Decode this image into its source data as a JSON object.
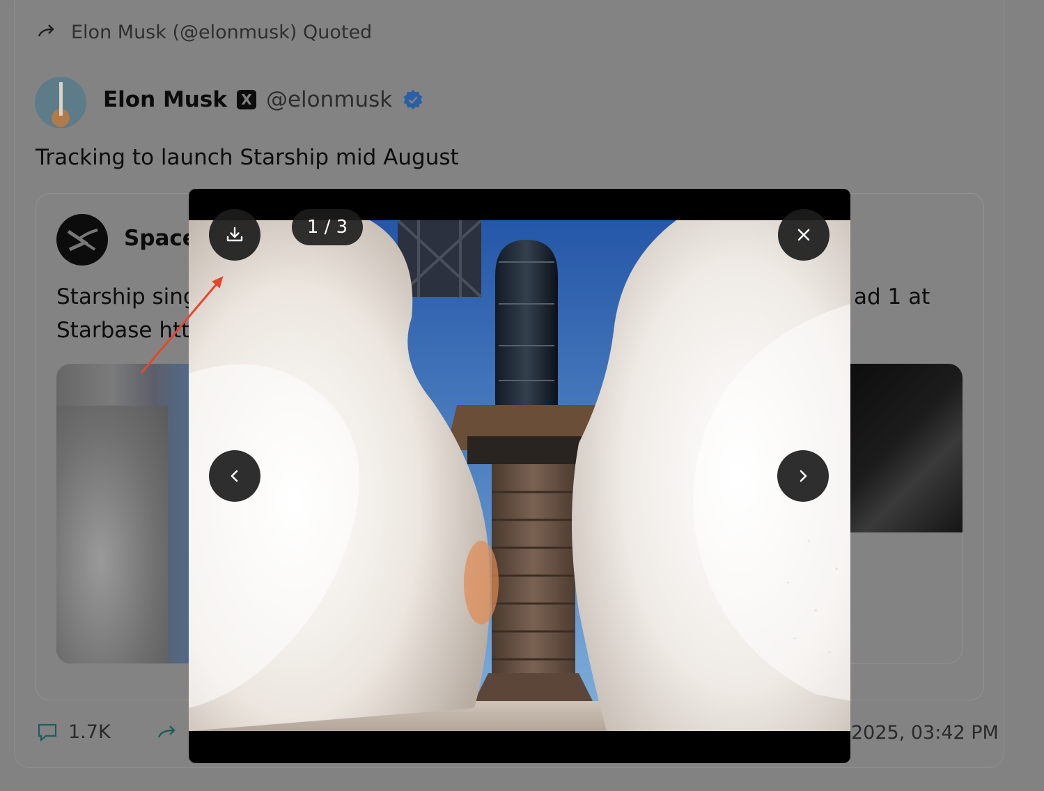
{
  "tweet": {
    "quoted_label": "Elon Musk (@elonmusk) Quoted",
    "author_name": "Elon Musk",
    "author_badge": "X",
    "author_handle": "@elonmusk",
    "text": "Tracking to launch Starship mid August"
  },
  "quoted_tweet": {
    "author_name": "SpaceX",
    "author_name_visible": "SpaceX",
    "text_line1_visible": "Starship singl",
    "text_line2_visible": "Starbase http",
    "text_line1_right_visible": "ad 1 at"
  },
  "actions": {
    "replies": "1.7K",
    "timestamp_visible": "2025, 03:42 PM"
  },
  "lightbox": {
    "counter": "1 / 3",
    "download_icon": "download-icon",
    "close_icon": "close-icon",
    "prev_icon": "chevron-left-icon",
    "next_icon": "chevron-right-icon"
  },
  "colors": {
    "overlay_bg": "#828282",
    "verified": "#2b5fa8",
    "control_bg": "#1c1c1c",
    "annotation_arrow": "#e8452c"
  }
}
